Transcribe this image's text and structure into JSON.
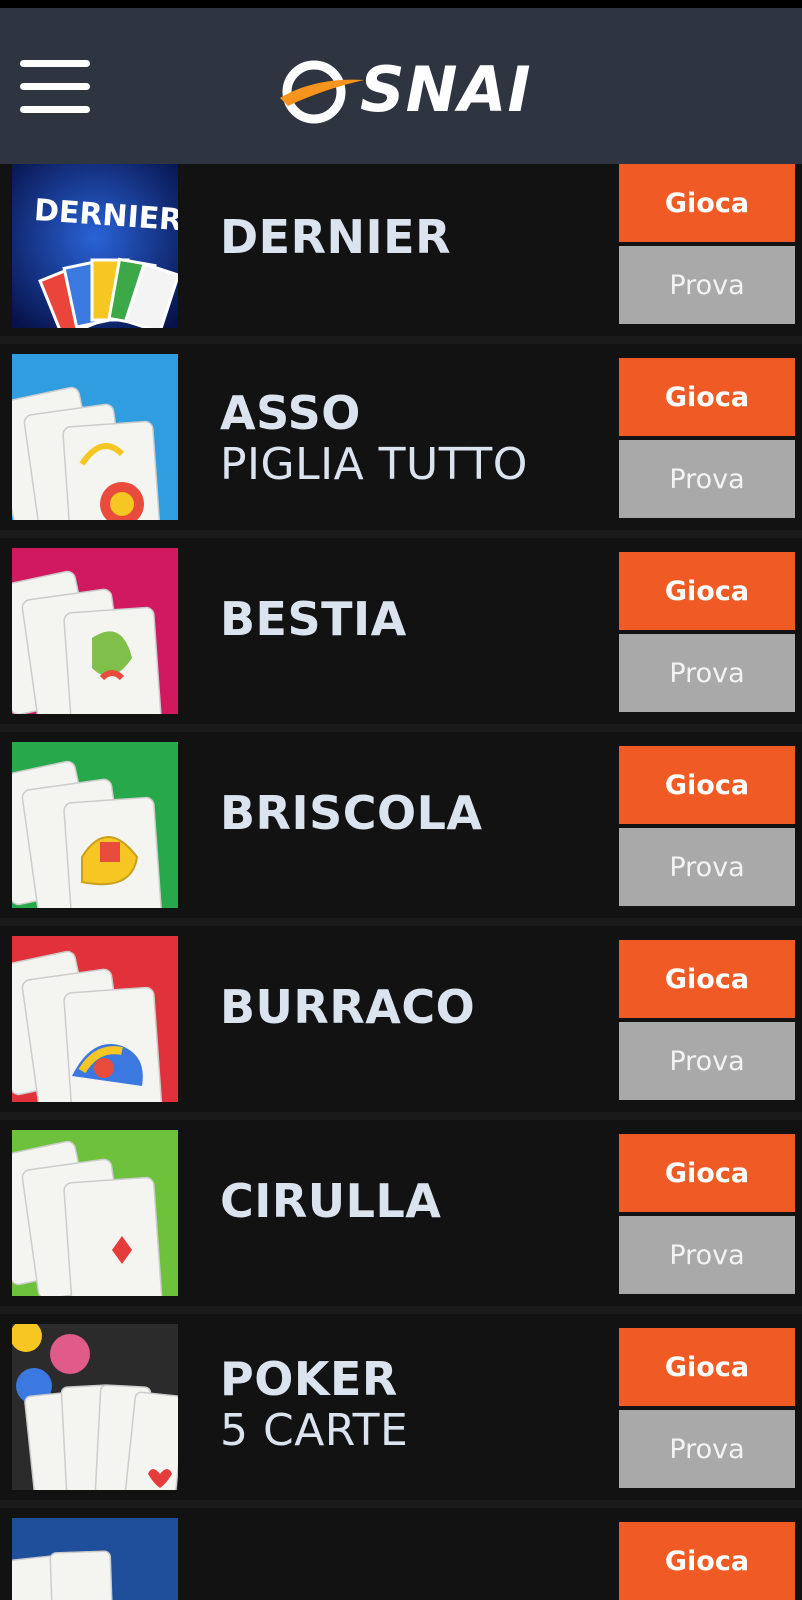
{
  "brand": {
    "logo_text": "SNAI"
  },
  "games": [
    {
      "title": "DERNIER",
      "subtitle": "",
      "play_label": "Gioca",
      "demo_label": "Prova"
    },
    {
      "title": "ASSO",
      "subtitle": "PIGLIA TUTTO",
      "play_label": "Gioca",
      "demo_label": "Prova"
    },
    {
      "title": "BESTIA",
      "subtitle": "",
      "play_label": "Gioca",
      "demo_label": "Prova"
    },
    {
      "title": "BRISCOLA",
      "subtitle": "",
      "play_label": "Gioca",
      "demo_label": "Prova"
    },
    {
      "title": "BURRACO",
      "subtitle": "",
      "play_label": "Gioca",
      "demo_label": "Prova"
    },
    {
      "title": "CIRULLA",
      "subtitle": "",
      "play_label": "Gioca",
      "demo_label": "Prova"
    },
    {
      "title": "POKER",
      "subtitle": "5 CARTE",
      "play_label": "Gioca",
      "demo_label": "Prova"
    },
    {
      "title": "",
      "subtitle": "",
      "play_label": "Gioca",
      "demo_label": ""
    }
  ],
  "colors": {
    "header_bg": "#2e3541",
    "play_button": "#f05a24",
    "demo_button": "#a9a9a9",
    "title_text": "#dbe3ef",
    "row_bg": "#121212"
  },
  "thumb_icons": [
    "dernier-thumb",
    "asso-thumb",
    "bestia-thumb",
    "briscola-thumb",
    "burraco-thumb",
    "cirulla-thumb",
    "poker-thumb",
    "next-game-thumb"
  ]
}
